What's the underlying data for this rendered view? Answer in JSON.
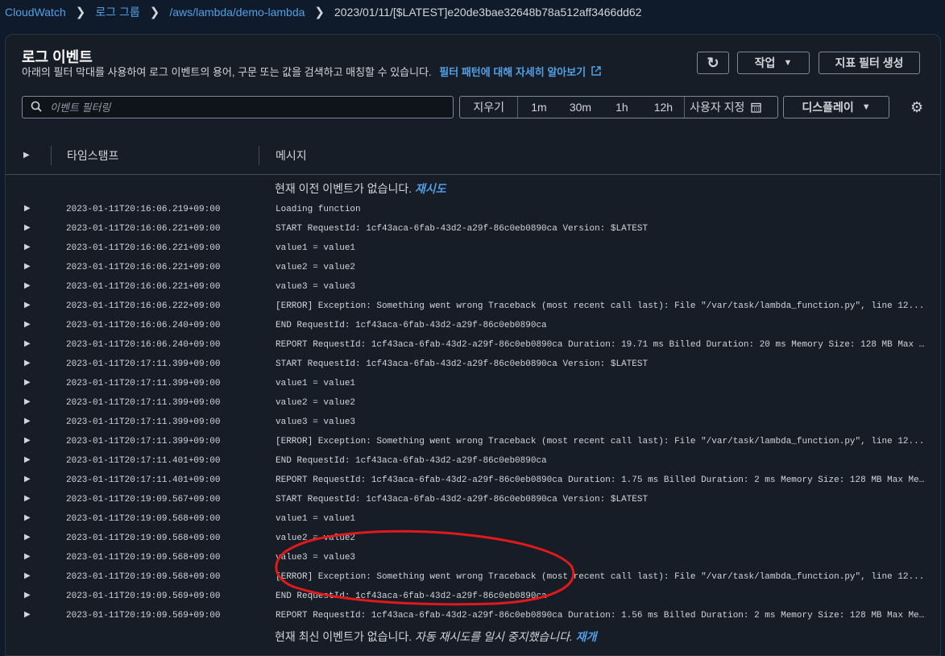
{
  "breadcrumb": {
    "items": [
      "CloudWatch",
      "로그 그룹",
      "/aws/lambda/demo-lambda"
    ],
    "current": "2023/01/11/[$LATEST]e20de3bae32648b78a512aff3466dd62"
  },
  "header": {
    "title": "로그 이벤트",
    "description": "아래의 필터 막대를 사용하여 로그 이벤트의 용어, 구문 또는 값을 검색하고 매칭할 수 있습니다.",
    "learn_more": "필터 패턴에 대해 자세히 알아보기",
    "actions_label": "작업",
    "metric_filter_label": "지표 필터 생성"
  },
  "filter": {
    "placeholder": "이벤트 필터링",
    "clear": "지우기",
    "ranges": [
      "1m",
      "30m",
      "1h",
      "12h"
    ],
    "custom": "사용자 지정",
    "display_label": "디스플레이"
  },
  "table": {
    "col_timestamp": "타임스탬프",
    "col_message": "메시지",
    "top_notice": "현재 이전 이벤트가 없습니다.",
    "retry": "재시도",
    "bottom_notice": "현재 최신 이벤트가 없습니다.",
    "paused": "자동 재시도를 일시 중지했습니다.",
    "resume": "재개",
    "rows": [
      {
        "ts": "2023-01-11T20:16:06.219+09:00",
        "msg": "Loading function"
      },
      {
        "ts": "2023-01-11T20:16:06.221+09:00",
        "msg": "START RequestId: 1cf43aca-6fab-43d2-a29f-86c0eb0890ca Version: $LATEST"
      },
      {
        "ts": "2023-01-11T20:16:06.221+09:00",
        "msg": "value1 = value1"
      },
      {
        "ts": "2023-01-11T20:16:06.221+09:00",
        "msg": "value2 = value2"
      },
      {
        "ts": "2023-01-11T20:16:06.221+09:00",
        "msg": "value3 = value3"
      },
      {
        "ts": "2023-01-11T20:16:06.222+09:00",
        "msg": "[ERROR] Exception: Something went wrong Traceback (most recent call last):   File \"/var/task/lambda_function.py\", line 12..."
      },
      {
        "ts": "2023-01-11T20:16:06.240+09:00",
        "msg": "END RequestId: 1cf43aca-6fab-43d2-a29f-86c0eb0890ca"
      },
      {
        "ts": "2023-01-11T20:16:06.240+09:00",
        "msg": "REPORT RequestId: 1cf43aca-6fab-43d2-a29f-86c0eb0890ca Duration: 19.71 ms Billed Duration: 20 ms Memory Size: 128 MB Max ..."
      },
      {
        "ts": "2023-01-11T20:17:11.399+09:00",
        "msg": "START RequestId: 1cf43aca-6fab-43d2-a29f-86c0eb0890ca Version: $LATEST"
      },
      {
        "ts": "2023-01-11T20:17:11.399+09:00",
        "msg": "value1 = value1"
      },
      {
        "ts": "2023-01-11T20:17:11.399+09:00",
        "msg": "value2 = value2"
      },
      {
        "ts": "2023-01-11T20:17:11.399+09:00",
        "msg": "value3 = value3"
      },
      {
        "ts": "2023-01-11T20:17:11.399+09:00",
        "msg": "[ERROR] Exception: Something went wrong Traceback (most recent call last):   File \"/var/task/lambda_function.py\", line 12..."
      },
      {
        "ts": "2023-01-11T20:17:11.401+09:00",
        "msg": "END RequestId: 1cf43aca-6fab-43d2-a29f-86c0eb0890ca"
      },
      {
        "ts": "2023-01-11T20:17:11.401+09:00",
        "msg": "REPORT RequestId: 1cf43aca-6fab-43d2-a29f-86c0eb0890ca Duration: 1.75 ms Billed Duration: 2 ms Memory Size: 128 MB Max Me..."
      },
      {
        "ts": "2023-01-11T20:19:09.567+09:00",
        "msg": "START RequestId: 1cf43aca-6fab-43d2-a29f-86c0eb0890ca Version: $LATEST"
      },
      {
        "ts": "2023-01-11T20:19:09.568+09:00",
        "msg": "value1 = value1"
      },
      {
        "ts": "2023-01-11T20:19:09.568+09:00",
        "msg": "value2 = value2"
      },
      {
        "ts": "2023-01-11T20:19:09.568+09:00",
        "msg": "value3 = value3"
      },
      {
        "ts": "2023-01-11T20:19:09.568+09:00",
        "msg": "[ERROR] Exception: Something went wrong Traceback (most recent call last):   File \"/var/task/lambda_function.py\", line 12..."
      },
      {
        "ts": "2023-01-11T20:19:09.569+09:00",
        "msg": "END RequestId: 1cf43aca-6fab-43d2-a29f-86c0eb0890ca"
      },
      {
        "ts": "2023-01-11T20:19:09.569+09:00",
        "msg": "REPORT RequestId: 1cf43aca-6fab-43d2-a29f-86c0eb0890ca Duration: 1.56 ms Billed Duration: 2 ms Memory Size: 128 MB Max Me..."
      }
    ]
  },
  "colors": {
    "background": "#0f1b2a",
    "panel": "#161d26",
    "link": "#539fe5",
    "annotation": "#e0191d"
  },
  "icons": {
    "refresh": "refresh-icon",
    "search": "search-icon",
    "calendar": "calendar-icon",
    "settings": "gear-icon",
    "external": "external-link-icon",
    "expand": "caret-right-icon"
  }
}
